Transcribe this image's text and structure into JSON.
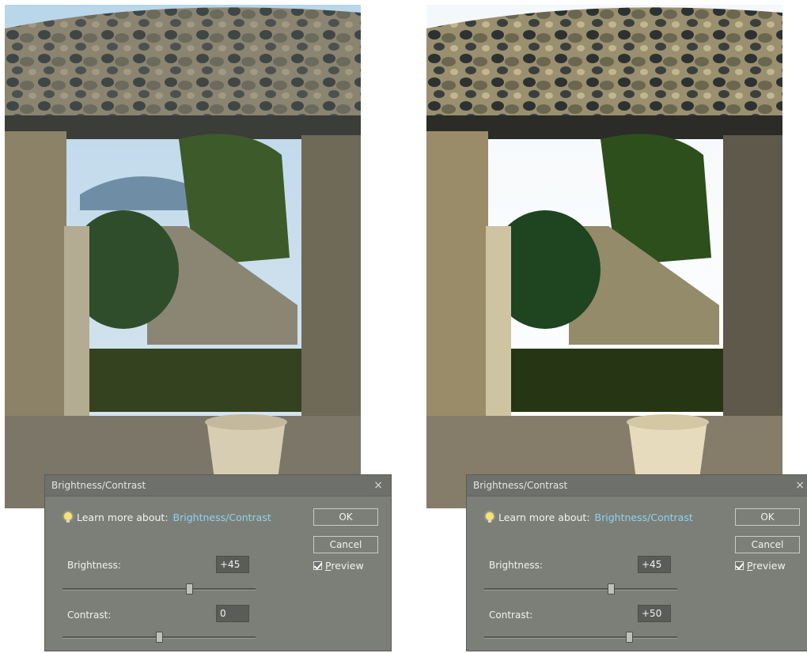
{
  "panels": [
    {
      "dialog": {
        "title": "Brightness/Contrast",
        "close_glyph": "×",
        "learn_prefix": "Learn more about:",
        "learn_link": "Brightness/Contrast",
        "ok_label": "OK",
        "cancel_label": "Cancel",
        "preview_label_first": "P",
        "preview_label_rest": "review",
        "preview_checked": true,
        "brightness_label": "Brightness:",
        "brightness_value": "+45",
        "brightness_fraction": 0.655,
        "contrast_label": "Contrast:",
        "contrast_value": "0",
        "contrast_fraction": 0.5
      }
    },
    {
      "dialog": {
        "title": "Brightness/Contrast",
        "close_glyph": "×",
        "learn_prefix": "Learn more about:",
        "learn_link": "Brightness/Contrast",
        "ok_label": "OK",
        "cancel_label": "Cancel",
        "preview_label_first": "P",
        "preview_label_rest": "review",
        "preview_checked": true,
        "brightness_label": "Brightness:",
        "brightness_value": "+45",
        "brightness_fraction": 0.655,
        "contrast_label": "Contrast:",
        "contrast_value": "+50",
        "contrast_fraction": 0.75
      }
    }
  ],
  "icons": {
    "bulb": "lightbulb-icon",
    "close": "close-icon",
    "check": "checkmark-icon"
  },
  "colors": {
    "dialog_bg": "#7c7f78",
    "link": "#8fd2ee"
  }
}
